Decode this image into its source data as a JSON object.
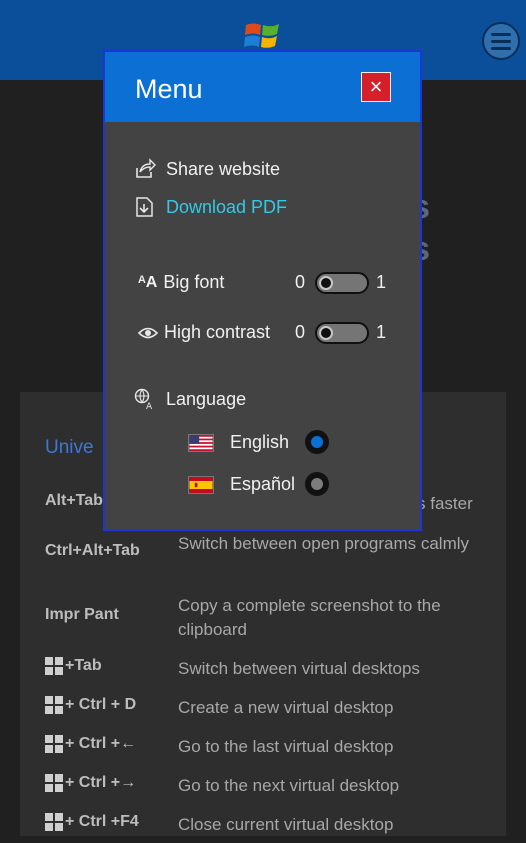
{
  "menu": {
    "title": "Menu",
    "close_label": "×",
    "share_label": "Share website",
    "download_label": "Download PDF",
    "big_font": {
      "label": "Big font",
      "left": "0",
      "right": "1",
      "value": 0
    },
    "high_contrast": {
      "label": "High contrast",
      "left": "0",
      "right": "1",
      "value": 0
    },
    "language_label": "Language",
    "languages": [
      {
        "label": "English",
        "flag": "us-flag",
        "selected": true
      },
      {
        "label": "Español",
        "flag": "spain-flag",
        "selected": false
      }
    ]
  },
  "background": {
    "panel_title_partial": "Unive",
    "shortcuts": [
      {
        "key": "Alt+Tab",
        "desc_partial": "s faster"
      },
      {
        "key": "Ctrl+Alt+Tab",
        "desc": "Switch between open programs calmly"
      },
      {
        "key": "Impr Pant",
        "desc": "Copy a complete screenshot to the clipboard"
      },
      {
        "key": "+Tab",
        "desc": "Switch between virtual desktops"
      },
      {
        "key": "+ Ctrl + D",
        "desc": "Create a new virtual desktop"
      },
      {
        "key": "+ Ctrl +←",
        "desc": "Go to the last virtual desktop"
      },
      {
        "key": "+ Ctrl +→",
        "desc": "Go to the next virtual desktop"
      },
      {
        "key": "+ Ctrl +F4",
        "desc": "Close current virtual desktop"
      }
    ]
  },
  "colors": {
    "header": "#0b4f9a",
    "menu_header": "#0b6fd3",
    "menu_bg": "#434343",
    "link": "#33c9e8",
    "close": "#d71f2a",
    "radio_selected": "#0b6fd3"
  },
  "icons": {
    "logo": "windows-logo-icon",
    "hamburger": "hamburger-icon",
    "share": "share-icon",
    "download": "download-icon",
    "font": "font-size-icon",
    "contrast": "eye-icon",
    "language": "globe-translate-icon"
  }
}
